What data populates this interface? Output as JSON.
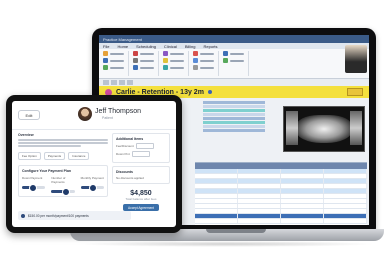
{
  "software": {
    "window_title": "Practice Management",
    "tabs": [
      "File",
      "Home",
      "Scheduling",
      "Clinical",
      "Billing",
      "Reports"
    ],
    "patient_name": "Carlie - Retention - 13y 2m",
    "colors": {
      "patient_bar": "#f4e03d",
      "accent": "#3d6fb6"
    }
  },
  "tablet": {
    "edit_button": "Edit",
    "name": "Jeff Thompson",
    "subtitle": "Patient",
    "section_a_title": "Overview",
    "tab_labels": [
      "Fee Option",
      "Payments",
      "Insurance"
    ],
    "section_b_title": "Configure Your Payment Plan",
    "slider_labels": [
      "Down Payment",
      "Number of Payments",
      "Monthly Payment"
    ],
    "slider_levels": [
      0.45,
      0.6,
      0.5
    ],
    "bottom_text": "$150.00 per month/payment/100 payments",
    "right_title": "Additional Items",
    "right_row_1": "Fee/Discount",
    "right_row_2": "Down Pmt",
    "discount_title": "Discounts",
    "discount_line": "No discounts applied",
    "price": "$4,850",
    "price_sub": "Total balance after fees",
    "cta_label": "Accept Agreement"
  }
}
